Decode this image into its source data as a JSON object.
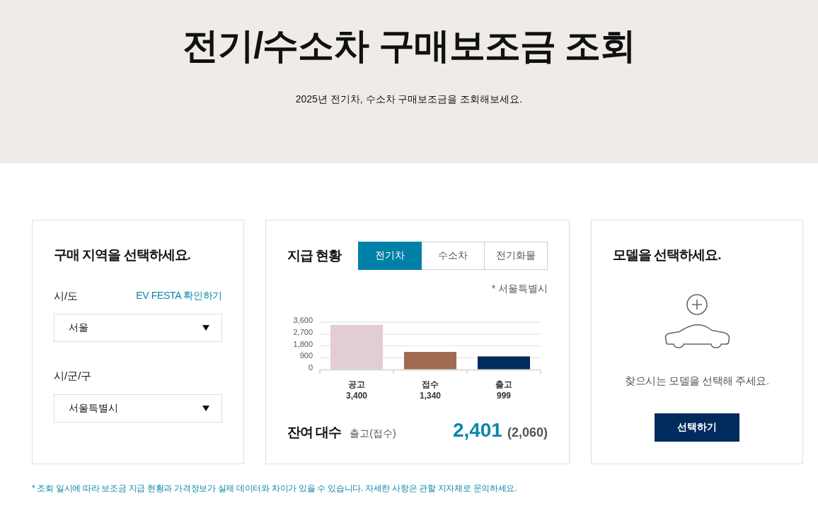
{
  "header": {
    "title": "전기/수소차 구매보조금 조회",
    "subtitle": "2025년 전기차, 수소차 구매보조금을 조회해보세요."
  },
  "region_panel": {
    "title": "구매 지역을 선택하세요.",
    "fields": [
      {
        "label": "시/도",
        "link": "EV FESTA 확인하기",
        "value": "서울"
      },
      {
        "label": "시/군/구",
        "value": "서울특별시"
      }
    ]
  },
  "status_panel": {
    "title": "지급 현황",
    "tabs": [
      {
        "label": "전기차",
        "selected": true
      },
      {
        "label": "수소차",
        "selected": false
      },
      {
        "label": "전기화물",
        "selected": false
      }
    ],
    "region_note": "* 서울특별시",
    "chart_data": [
      {
        "type": "bar",
        "categories": [
          "공고",
          "접수",
          "출고"
        ],
        "values": [
          3400,
          1340,
          999
        ],
        "colors": [
          "#e3cdd5",
          "#a06b50",
          "#002b5c"
        ],
        "value_labels": [
          "3,400",
          "1,340",
          "999"
        ],
        "ylim": [
          0,
          3600
        ],
        "yticks": [
          0,
          900,
          {
            "value": 1800,
            "label": "1,800"
          },
          {
            "value": 2700,
            "label": "2,700"
          },
          {
            "value": 3600,
            "label": "3,600"
          }
        ],
        "grid": true
      }
    ],
    "remaining": {
      "label": "잔여 대수",
      "sublabel": "출고(접수)",
      "value": "2,401",
      "secondary_value": "(2,060)"
    }
  },
  "model_panel": {
    "title": "모델을 선택하세요.",
    "message": "찾으시는 모델을 선택해 주세요.",
    "button": "선택하기"
  },
  "footnote": "* 조회 일시에 따라 보조금 지급 현황과 가격정보가 실제 데이터와 차이가 있을 수 있습니다. 자세한 사항은 관할 지자체로 문의하세요."
}
